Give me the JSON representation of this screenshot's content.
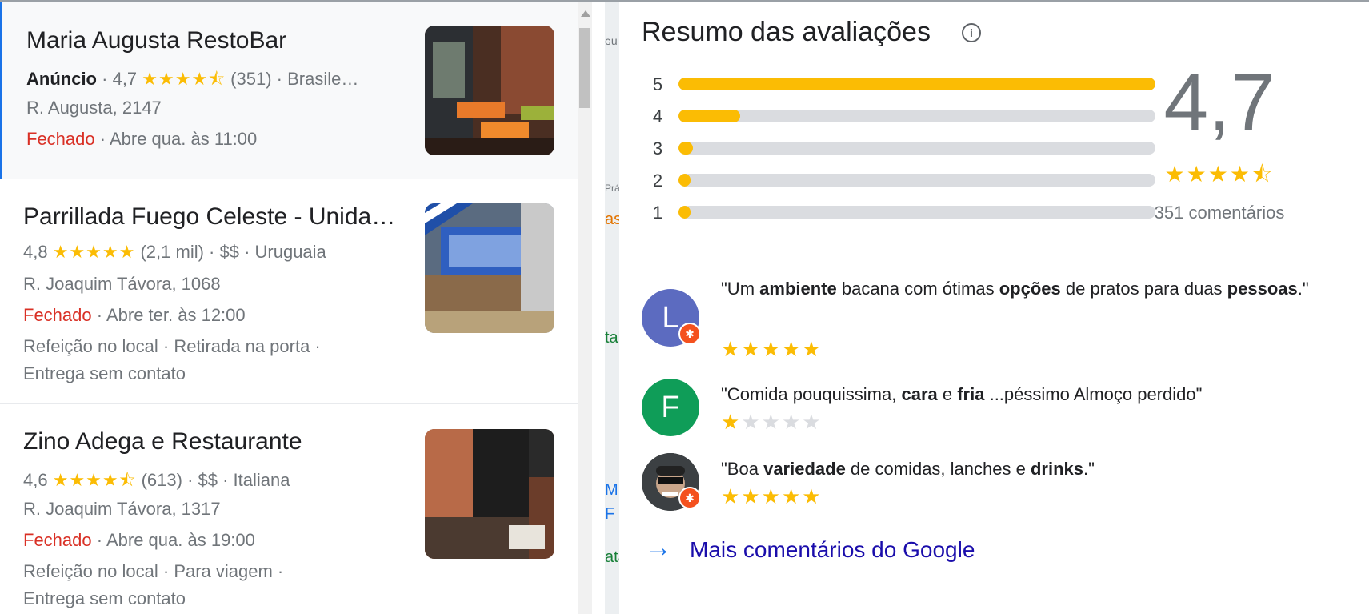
{
  "results": [
    {
      "name": "Maria Augusta RestoBar",
      "ad_label": "Anúncio",
      "rating": "4,7",
      "stars": "★★★★⯪",
      "reviews": "(351)",
      "category": "· Brasile…",
      "address": "R. Augusta, 2147",
      "status": "Fechado",
      "hours": "· Abre qua. às 11:00",
      "services": "",
      "services2": ""
    },
    {
      "name": "Parrillada Fuego Celeste - Unida…",
      "rating": "4,8",
      "stars": "★★★★★",
      "reviews": "(2,1 mil)",
      "category": "· $$ · Uruguaia",
      "address": "R. Joaquim Távora, 1068",
      "status": "Fechado",
      "hours": "· Abre ter. às 12:00",
      "services": "Refeição no local · Retirada na porta ·",
      "services2": "Entrega sem contato"
    },
    {
      "name": "Zino Adega e Restaurante",
      "rating": "4,6",
      "stars": "★★★★⯪",
      "reviews": "(613)",
      "category": "· $$ · Italiana",
      "address": "R. Joaquim Távora, 1317",
      "status": "Fechado",
      "hours": "· Abre qua. às 19:00",
      "services": "Refeição no local · Para viagem ·",
      "services2": "Entrega sem contato"
    }
  ],
  "map_fragments": [
    "ɢu",
    "Prás",
    "as",
    "tal",
    "M",
    "F",
    "ata"
  ],
  "summary": {
    "title": "Resumo das avaliações",
    "info_icon": "info-icon",
    "average": "4,7",
    "average_stars": "★★★★⯪",
    "count": "351 comentários",
    "distribution": [
      {
        "star": "5",
        "fraction": 1.0
      },
      {
        "star": "4",
        "fraction": 0.13
      },
      {
        "star": "3",
        "fraction": 0.03
      },
      {
        "star": "2",
        "fraction": 0.01
      },
      {
        "star": "1",
        "fraction": 0.02
      }
    ]
  },
  "reviews": [
    {
      "avatar_letter": "L",
      "avatar_color": "#5c6bc0",
      "rating": 5,
      "parts": [
        "\"Um ",
        "ambiente",
        " bacana com ótimas ",
        "opções",
        " de pratos para duas ",
        "pessoas",
        ".\""
      ]
    },
    {
      "avatar_letter": "F",
      "avatar_color": "#0f9d58",
      "rating": 1,
      "parts": [
        "\"Comida pouquissima, ",
        "cara",
        " e ",
        "fria",
        " ...péssimo Almoço perdido\""
      ]
    },
    {
      "avatar_letter": "",
      "avatar_color": "#3c4043",
      "rating": 5,
      "parts": [
        "\"Boa ",
        "variedade",
        " de comidas, lanches e ",
        "drinks",
        ".\""
      ]
    }
  ],
  "more_link": "Mais comentários do Google",
  "colors": {
    "star": "#fbbc04",
    "closed": "#d93025",
    "link": "#1a0dab",
    "accent": "#1a73e8"
  }
}
